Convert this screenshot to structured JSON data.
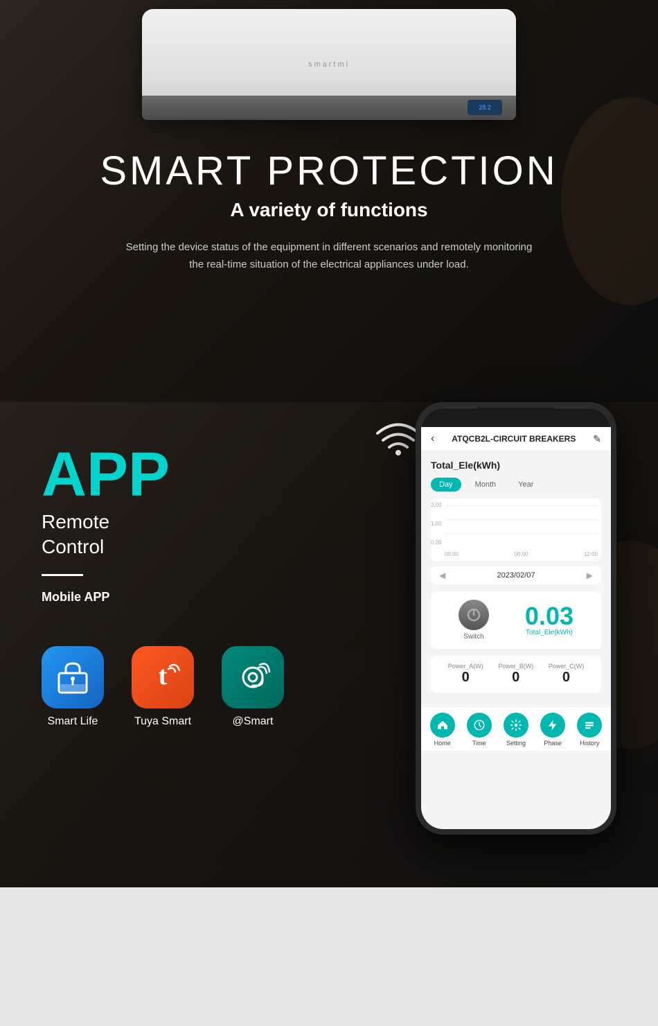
{
  "hero": {
    "title": "SMART PROTECTION",
    "subtitle": "A variety of functions",
    "description": "Setting the device status of the equipment in different\nscenarios and remotely monitoring\nthe real-time situation of the electrical appliances under load.",
    "ac_brand": "smartmi"
  },
  "app_section": {
    "app_title": "APP",
    "remote_label": "Remote\nControl",
    "mobile_label": "Mobile APP"
  },
  "phone": {
    "header_title": "ATQCB2L-CIRCUIT BREAKERS",
    "back_icon": "‹",
    "edit_icon": "✎",
    "energy_label": "Total_Ele(kWh)",
    "tabs": [
      "Day",
      "Month",
      "Year"
    ],
    "active_tab": "Day",
    "date": "2023/02/07",
    "chart_y": [
      "2.00",
      "1.00",
      "0.00"
    ],
    "chart_x": [
      "00:00",
      "06:00",
      "12:00"
    ],
    "switch_label": "Switch",
    "energy_value": "0.03",
    "energy_unit": "Total_Ele(kWh)",
    "power_readings": [
      {
        "label": "Power_A(W)",
        "value": "0"
      },
      {
        "label": "Power_B(W)",
        "value": "0"
      },
      {
        "label": "Power_C(W)",
        "value": "0"
      }
    ],
    "nav_items": [
      {
        "label": "Home",
        "icon": "home"
      },
      {
        "label": "Time",
        "icon": "time"
      },
      {
        "label": "Setting",
        "icon": "setting"
      },
      {
        "label": "Phase",
        "icon": "phase"
      },
      {
        "label": "History",
        "icon": "history"
      }
    ]
  },
  "apps": [
    {
      "label": "Smart Life",
      "color": "blue"
    },
    {
      "label": "Tuya Smart",
      "color": "orange"
    },
    {
      "label": "@Smart",
      "color": "teal"
    }
  ]
}
